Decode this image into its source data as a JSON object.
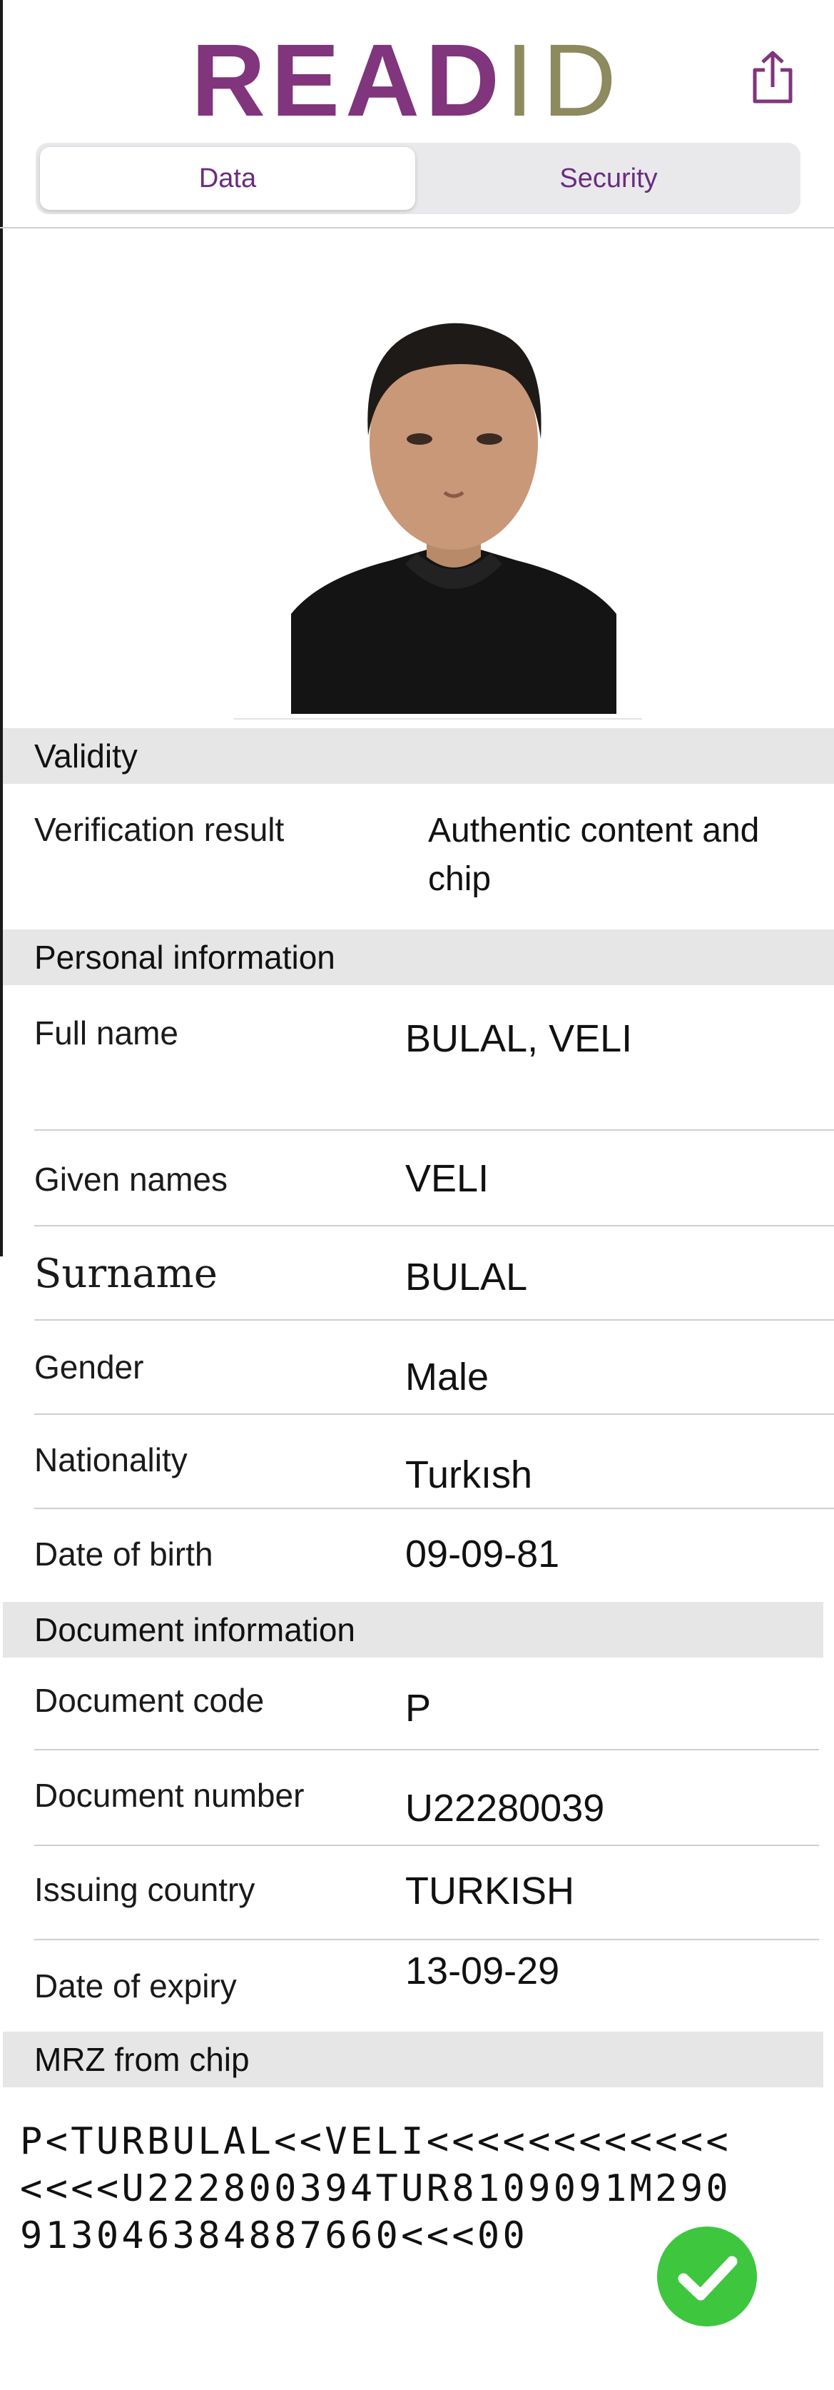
{
  "app": {
    "logo_read": "READ",
    "logo_id": "ID",
    "brand_color": "#80357c",
    "tabs": [
      {
        "label": "Data",
        "active": true
      },
      {
        "label": "Security",
        "active": false
      }
    ]
  },
  "validity": {
    "title": "Validity",
    "rows": [
      {
        "label": "Verification result",
        "value": "Authentic content and chip"
      }
    ]
  },
  "personal": {
    "title": "Personal information",
    "rows": [
      {
        "label": "Full name",
        "value": "BULAL, VELI"
      },
      {
        "label": "Given names",
        "value": "VELI"
      },
      {
        "label": "Surname",
        "value": "BULAL"
      },
      {
        "label": "Gender",
        "value": "Male"
      },
      {
        "label": "Nationality",
        "value": "Turkısh"
      },
      {
        "label": "Date of birth",
        "value": "09-09-81"
      }
    ]
  },
  "document": {
    "title": "Document information",
    "rows": [
      {
        "label": "Document code",
        "value": "P"
      },
      {
        "label": "Document number",
        "value": "U22280039"
      },
      {
        "label": "Issuing country",
        "value": "TURKISH"
      },
      {
        "label": "Date of expiry",
        "value": "13-09-29"
      }
    ]
  },
  "mrz": {
    "title": "MRZ from chip",
    "lines": [
      "P<TURBULAL<<VELI<<<<<<<<<<<<",
      "<<<<U222800394TUR8109091M290",
      "913046384887660<<<00"
    ]
  },
  "status": {
    "icon": "checkmark-circle-icon",
    "color": "#3ec63e"
  }
}
